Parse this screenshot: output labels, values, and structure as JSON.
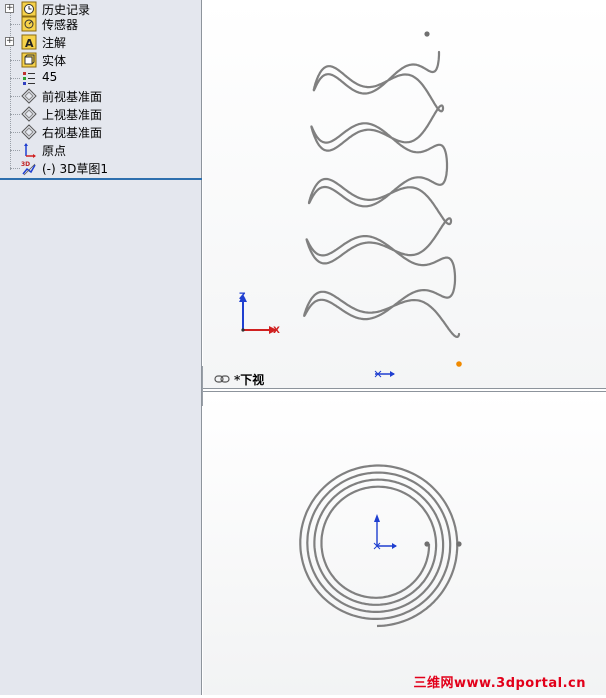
{
  "feature_tree": {
    "items": [
      {
        "label": "历史记录",
        "icon": "history-icon",
        "expandable": true
      },
      {
        "label": "传感器",
        "icon": "sensor-icon",
        "expandable": false
      },
      {
        "label": "注解",
        "icon": "annotation-icon",
        "expandable": true
      },
      {
        "label": "实体",
        "icon": "solid-body-icon",
        "expandable": false
      },
      {
        "label": "45",
        "icon": "material-icon",
        "expandable": false
      },
      {
        "label": "前视基准面",
        "icon": "plane-icon",
        "expandable": false
      },
      {
        "label": "上视基准面",
        "icon": "plane-icon",
        "expandable": false
      },
      {
        "label": "右视基准面",
        "icon": "plane-icon",
        "expandable": false
      },
      {
        "label": "原点",
        "icon": "origin-icon",
        "expandable": false
      },
      {
        "label": "(-) 3D草图1",
        "icon": "3d-sketch-icon",
        "expandable": false
      }
    ]
  },
  "viewport_top": {
    "triad": {
      "x_label": "X",
      "y_label": "Z"
    }
  },
  "view_label": "*下视",
  "colors": {
    "panel_bg": "#e4e7ee",
    "selection_line": "#2d6fae",
    "curve": "#808080",
    "axis_x": "#d02020",
    "axis_y": "#1f3fd0",
    "endpoint": "#f08a00",
    "watermark": "#e2001a"
  },
  "watermark": "三维网www.3dportal.cn"
}
